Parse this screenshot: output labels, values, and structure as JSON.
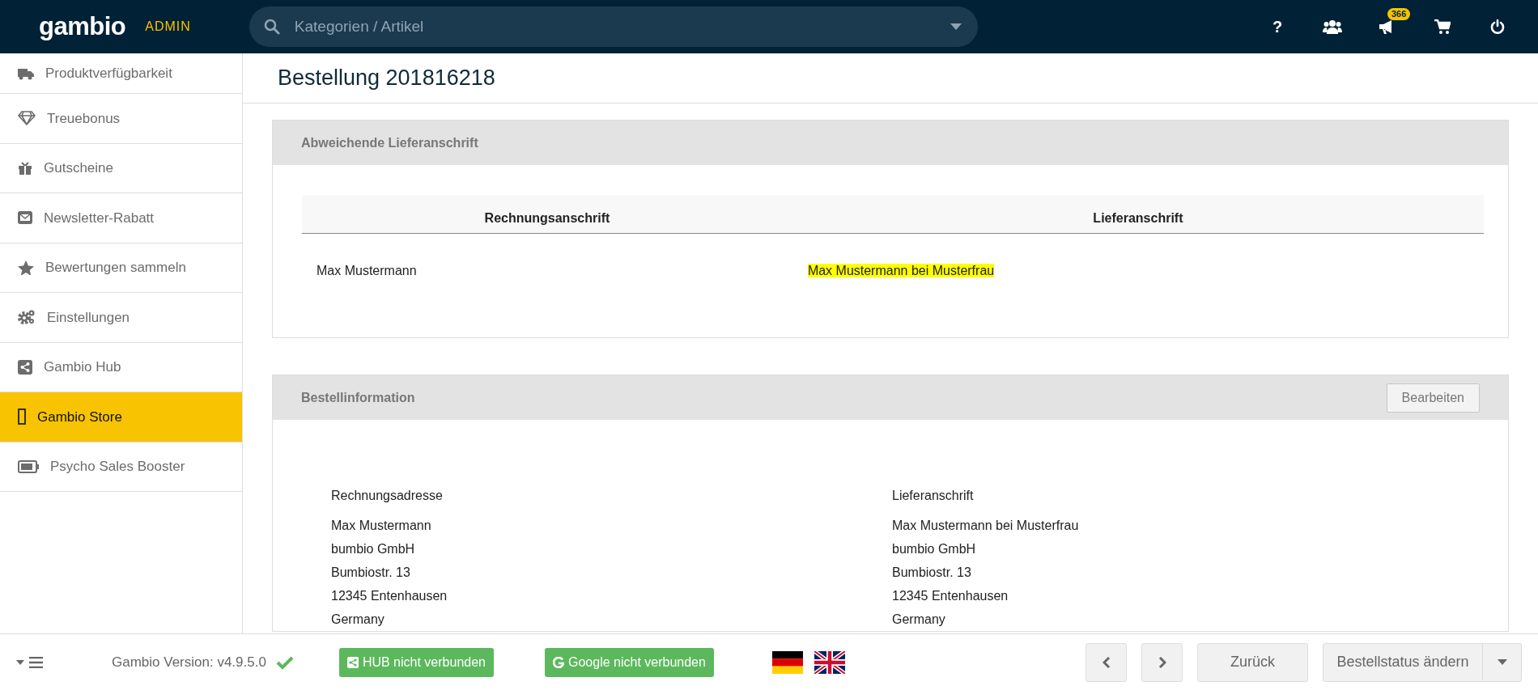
{
  "topbar": {
    "logo": "gambio",
    "logo_suffix": "ADMIN",
    "search": {
      "placeholder": "Kategorien / Artikel"
    },
    "icons": [
      {
        "kind": "help",
        "label": "?"
      },
      {
        "kind": "users"
      },
      {
        "kind": "megaphone",
        "badge": "366"
      },
      {
        "kind": "cart"
      },
      {
        "kind": "power"
      }
    ]
  },
  "sidebar": {
    "items": [
      {
        "kind": "truck",
        "label": "Produktverfügbarkeit",
        "selected": false
      },
      {
        "kind": "diamond",
        "label": "Treuebonus",
        "selected": false
      },
      {
        "kind": "gift",
        "label": "Gutscheine",
        "selected": false
      },
      {
        "kind": "envelope",
        "label": "Newsletter-Rabatt",
        "selected": false
      },
      {
        "kind": "star",
        "label": "Bewertungen sammeln",
        "selected": false
      },
      {
        "kind": "gears",
        "label": "Einstellungen",
        "selected": false
      },
      {
        "kind": "share",
        "label": "Gambio Hub",
        "selected": false
      },
      {
        "kind": "store",
        "label": "Gambio Store",
        "selected": true
      },
      {
        "kind": "battery",
        "label": "Psycho Sales Booster",
        "selected": false
      }
    ]
  },
  "page_title": "Bestellung 201816218",
  "delivery_card": {
    "title": "Abweichende Lieferanschrift",
    "columns": [
      "Rechnungsanschrift",
      "Lieferanschrift"
    ],
    "cells": [
      {
        "text": "Max Mustermann",
        "highlighted": false
      },
      {
        "text": "Max Mustermann bei Musterfrau",
        "highlighted": true
      }
    ]
  },
  "order_card": {
    "title": "Bestellinformation",
    "edit_button": "Bearbeiten",
    "addresses": [
      {
        "heading": "Rechnungsadresse",
        "lines": [
          "Max Mustermann",
          "bumbio GmbH",
          "Bumbiostr. 13",
          "12345 Entenhausen",
          "Germany"
        ]
      },
      {
        "heading": "Lieferanschrift",
        "lines": [
          "Max Mustermann bei Musterfrau",
          "bumbio GmbH",
          "Bumbiostr. 13",
          "12345 Entenhausen",
          "Germany"
        ]
      }
    ]
  },
  "footer": {
    "version": "Gambio Version: v4.9.5.0",
    "status_buttons": [
      {
        "kind": "hub",
        "label": "HUB nicht verbunden"
      },
      {
        "kind": "google",
        "label": "Google nicht verbunden"
      }
    ],
    "languages": [
      {
        "kind": "de"
      },
      {
        "kind": "en"
      }
    ],
    "back_button": "Zurück",
    "status_button": "Bestellstatus ändern"
  }
}
